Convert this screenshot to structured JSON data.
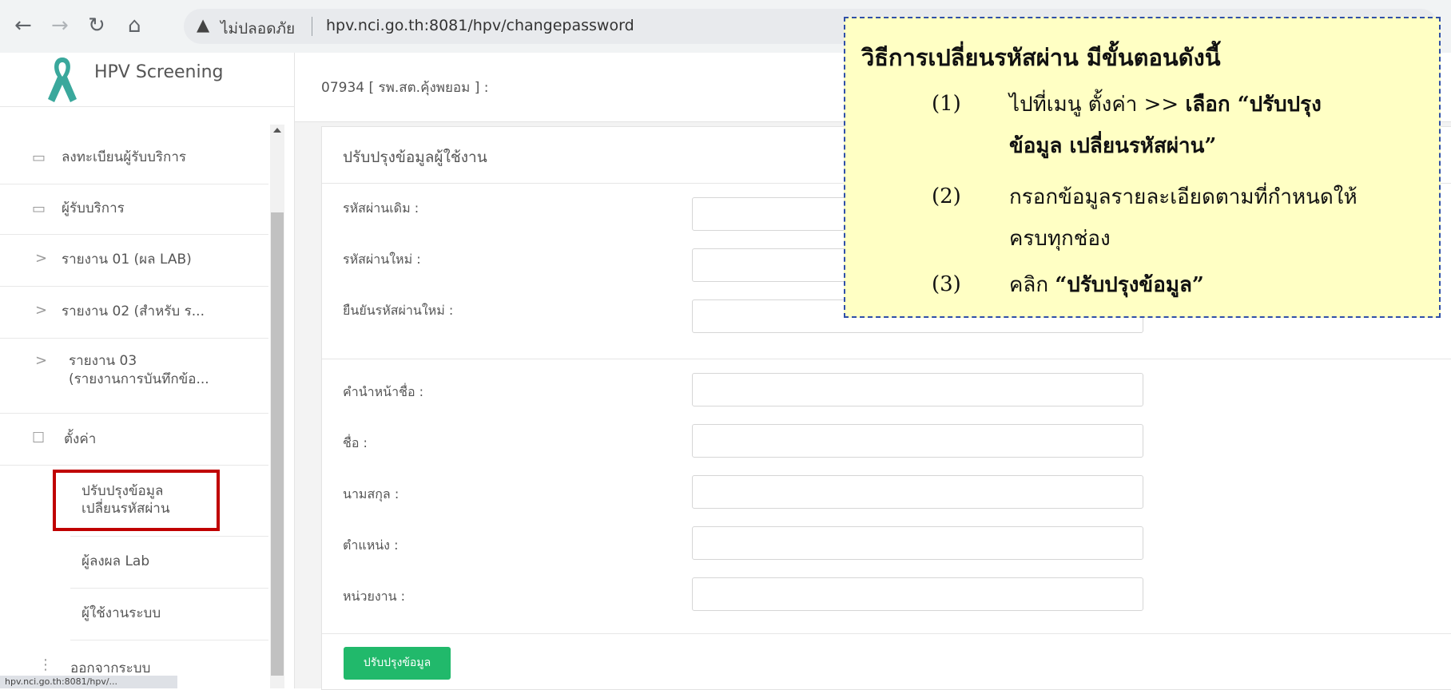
{
  "browser": {
    "insecure_label": "ไม่ปลอดภัย",
    "url": "hpv.nci.go.th:8081/hpv/changepassword"
  },
  "brand": {
    "title": "HPV Screening"
  },
  "header": {
    "user_unit": "07934 [ รพ.สต.คุ้งพยอม ] :"
  },
  "sidebar": {
    "items": [
      {
        "label": "ลงทะเบียนผู้รับบริการ"
      },
      {
        "label": "ผู้รับบริการ"
      },
      {
        "label": "รายงาน 01 (ผล LAB)"
      },
      {
        "label": "รายงาน 02 (สำหรับ ร..."
      },
      {
        "label": "รายงาน 03",
        "label2": "(รายงานการบันทึกข้อ..."
      },
      {
        "label": "ตั้งค่า"
      }
    ],
    "sub_items": [
      {
        "label": "ปรับปรุงข้อมูล",
        "label2": "เปลี่ยนรหัสผ่าน"
      },
      {
        "label": "ผู้ลงผล Lab"
      },
      {
        "label": "ผู้ใช้งานระบบ"
      }
    ],
    "logout": "ออกจากระบบ"
  },
  "form": {
    "title": "ปรับปรุงข้อมูลผู้ใช้งาน",
    "fields": [
      {
        "label": "รหัสผ่านเดิม :",
        "value": ""
      },
      {
        "label": "รหัสผ่านใหม่ :",
        "value": ""
      },
      {
        "label": "ยืนยันรหัสผ่านใหม่ :",
        "value": ""
      },
      {
        "label": "คำนำหน้าชื่อ :",
        "value": ""
      },
      {
        "label": "ชื่อ :",
        "value": ""
      },
      {
        "label": "นามสกุล :",
        "value": ""
      },
      {
        "label": "ตำแหน่ง :",
        "value": ""
      },
      {
        "label": "หน่วยงาน :",
        "value": ""
      }
    ],
    "submit_label": "ปรับปรุงข้อมูล"
  },
  "callout": {
    "title": "วิธีการเปลี่ยนรหัสผ่าน มีขั้นตอนดังนี้",
    "steps": [
      {
        "num": "(1)",
        "line1_plain": "ไปที่เมนู ตั้งค่า >> ",
        "line1_bold": "เลือก “ปรับปรุง",
        "line2_bold": "ข้อมูล เปลี่ยนรหัสผ่าน”"
      },
      {
        "num": "(2)",
        "line1_plain": "กรอกข้อมูลรายละเอียดตามที่กำหนดให้",
        "line2_plain": "ครบทุกช่อง"
      },
      {
        "num": "(3)",
        "line1_plain": "คลิก ",
        "line1_bold": "“ปรับปรุงข้อมูล”"
      }
    ]
  },
  "statusbar": {
    "text": "hpv.nci.go.th:8081/hpv/..."
  },
  "colors": {
    "save_button": "#21b96b",
    "highlight": "#c00000",
    "callout_bg": "#ffffc4",
    "callout_border": "#2f4fa8"
  }
}
